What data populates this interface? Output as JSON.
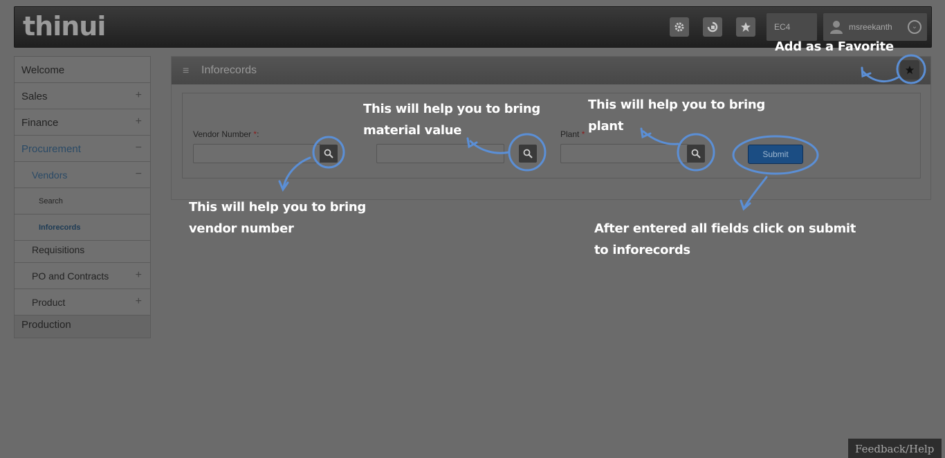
{
  "header": {
    "logo": "thinui",
    "settings_icon": "gear-icon",
    "apps_icon": "app-switch-icon",
    "favorites_icon": "star-icon",
    "env": "EC4",
    "username": "msreekanth"
  },
  "sidebar": {
    "items": [
      {
        "label": "Welcome"
      },
      {
        "label": "Sales",
        "toggle": "+"
      },
      {
        "label": "Finance",
        "toggle": "+"
      },
      {
        "label": "Procurement",
        "toggle": "−"
      },
      {
        "label": "Vendors",
        "toggle": "−"
      },
      {
        "label": "Search"
      },
      {
        "label": "Inforecords"
      },
      {
        "label": "Requisitions"
      },
      {
        "label": "PO and Contracts",
        "toggle": "+"
      },
      {
        "label": "Product",
        "toggle": "+"
      },
      {
        "label": "Production"
      }
    ]
  },
  "panel": {
    "title": "Inforecords",
    "fields": {
      "vendor_label": "Vendor Number",
      "vendor_colon": ":",
      "required_mark": "*",
      "plant_label": "Plant",
      "submit_label": "Submit"
    }
  },
  "annotations": {
    "favorite": "Add as a Favorite",
    "vendor_line1": "This will help    you to bring",
    "vendor_line2": "vendor number",
    "material_line1": "This will help    you to bring",
    "material_line2": "material value",
    "plant_line1": "This will help    you to bring",
    "plant_line2": "plant",
    "submit_line1": "After entered all fields click on submit",
    "submit_line2": "to inforecords"
  },
  "footer": {
    "feedback": "Feedback/Help"
  },
  "colors": {
    "annotation_stroke": "#5b8fd6",
    "submit": "#1b4d83"
  }
}
